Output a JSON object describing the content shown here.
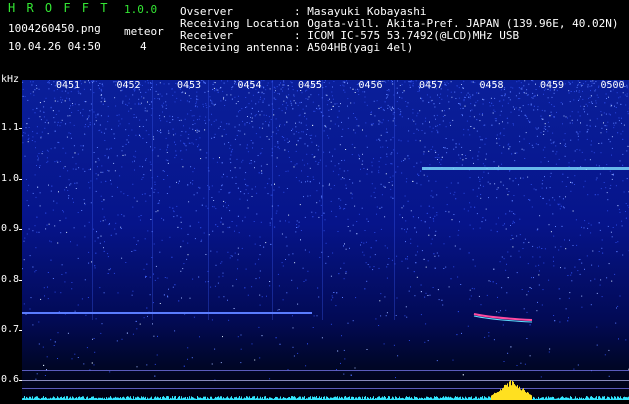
{
  "header": {
    "app_title": "H R O F F T",
    "version": "1.0.0",
    "filename": "1004260450.png",
    "datetime": "10.04.26 04:50",
    "mode_label": "meteor",
    "count": "4",
    "fields": [
      {
        "label": "Ovserver",
        "value": ": Masayuki Kobayashi"
      },
      {
        "label": "Receiving Location",
        "value": ": Ogata-vill. Akita-Pref. JAPAN (139.96E, 40.02N)"
      },
      {
        "label": "Receiver",
        "value": ": ICOM IC-575 53.7492(@LCD)MHz USB"
      },
      {
        "label": "Receiving antenna",
        "value": ": A504HB(yagi 4el)"
      }
    ]
  },
  "spectrogram": {
    "y_unit": "kHz",
    "y_ticks": [
      "1.1",
      "1.0",
      "0.9",
      "0.8",
      "0.7",
      "0.6"
    ],
    "time_labels": [
      "0451",
      "0452",
      "0453",
      "0454",
      "0455",
      "0456",
      "0457",
      "0458",
      "0459",
      "0500"
    ]
  }
}
